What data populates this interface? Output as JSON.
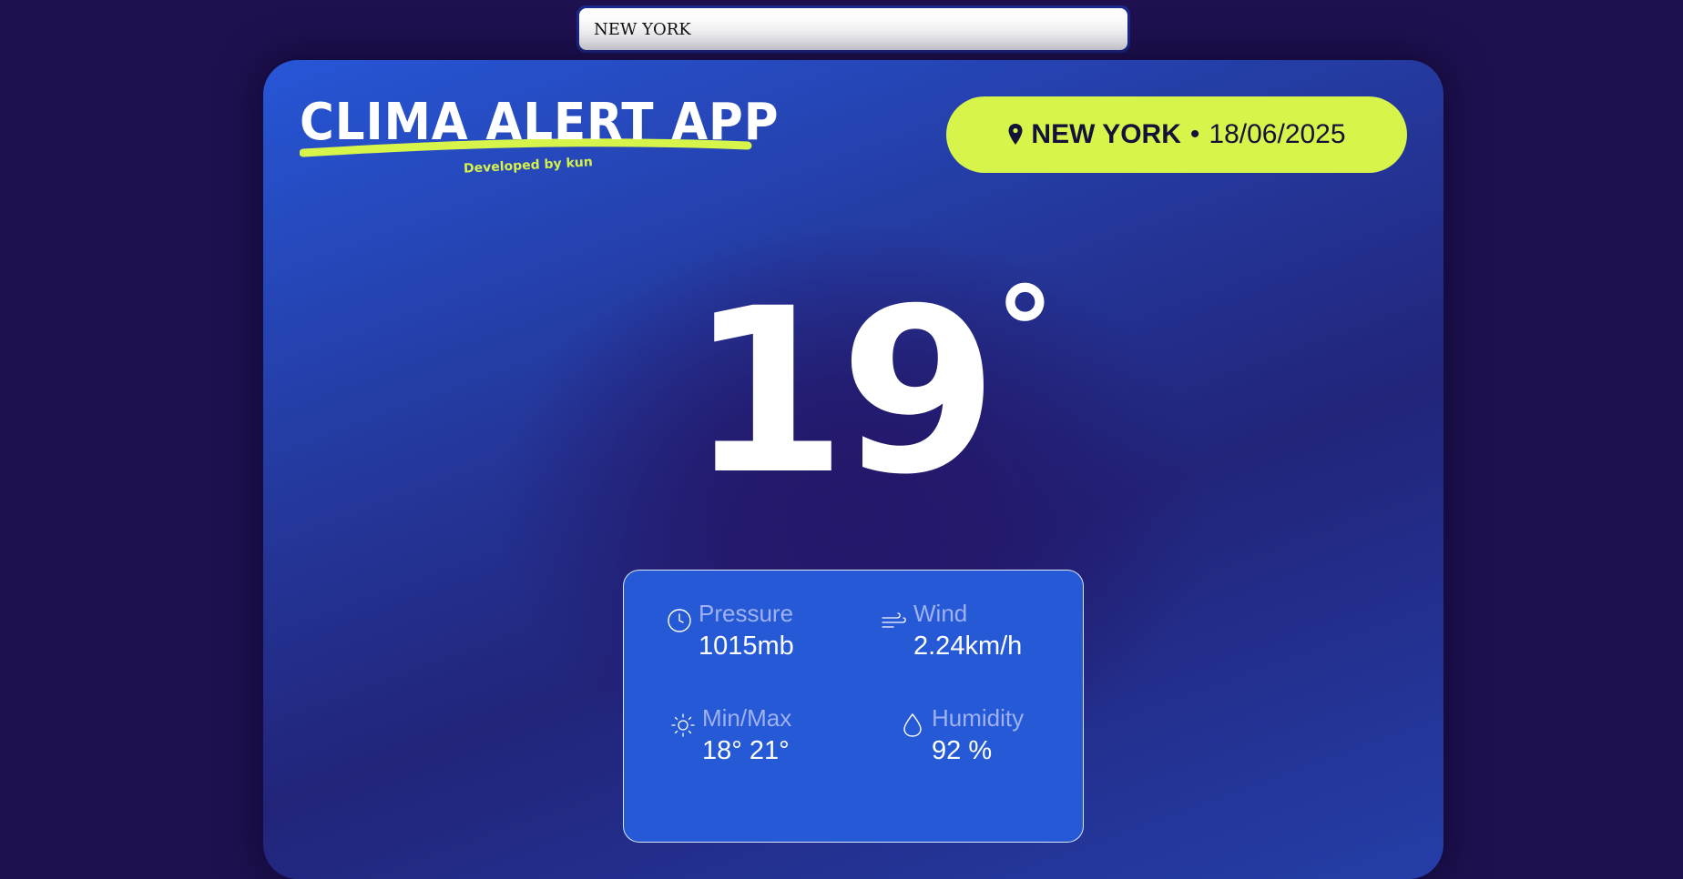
{
  "search": {
    "value": "NEW YORK"
  },
  "logo": {
    "title": "CLIMA ALERT APP",
    "subtitle": "Developed by kun"
  },
  "location": {
    "city": "NEW YORK",
    "separator": "•",
    "date": "18/06/2025",
    "icon": "map-pin-icon"
  },
  "temperature": {
    "value": "19",
    "unit": "°"
  },
  "stats": {
    "pressure": {
      "label": "Pressure",
      "value": "1015mb",
      "icon": "gauge-icon"
    },
    "wind": {
      "label": "Wind",
      "value": "2.24km/h",
      "icon": "wind-icon"
    },
    "minmax": {
      "label": "Min/Max",
      "value": "18° 21°",
      "icon": "sun-icon"
    },
    "humidity": {
      "label": "Humidity",
      "value": "92 %",
      "icon": "droplet-icon"
    }
  },
  "colors": {
    "background": "#1f1150",
    "card_top": "#2756d6",
    "accent": "#d7f44a",
    "stats_panel": "#2559d6",
    "label": "#9fb1f0"
  }
}
